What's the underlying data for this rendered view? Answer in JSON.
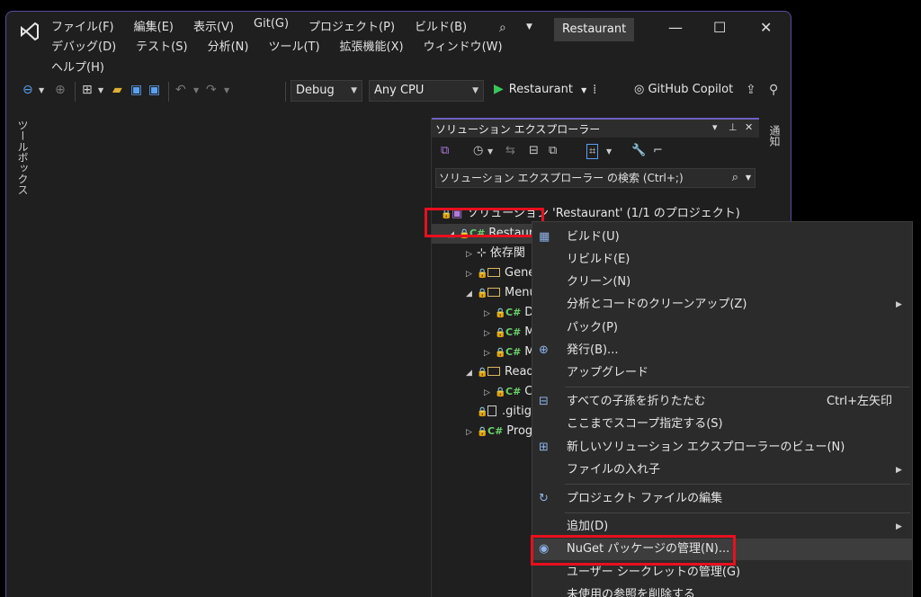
{
  "titlebar": {
    "menu_row1": [
      "ファイル(F)",
      "編集(E)",
      "表示(V)",
      "Git(G)",
      "プロジェクト(P)",
      "ビルド(B)"
    ],
    "menu_row2": [
      "デバッグ(D)",
      "テスト(S)",
      "分析(N)",
      "ツール(T)",
      "拡張機能(X)",
      "ウィンドウ(W)"
    ],
    "menu_row3": [
      "ヘルプ(H)"
    ],
    "solution_name": "Restaurant",
    "search_icon": "search-icon"
  },
  "toolbar": {
    "configuration": "Debug",
    "platform": "Any CPU",
    "run_target": "Restaurant",
    "copilot": "GitHub Copilot"
  },
  "toolbox": {
    "label": "ツールボックス"
  },
  "notifications": {
    "label": "通知"
  },
  "solution_explorer": {
    "title": "ソリューション エクスプローラー",
    "search_placeholder": "ソリューション エクスプローラー の検索 (Ctrl+;)",
    "tree": {
      "solution": "ソリューション 'Restaurant' (1/1 のプロジェクト)",
      "project": "Restaurant",
      "items": [
        "依存関",
        "Gene",
        "Menu",
        "D",
        "M",
        "M",
        "Read",
        "C",
        ".gitig",
        "Prog"
      ]
    }
  },
  "context_menu": {
    "items": [
      {
        "label": "ビルド(U)",
        "icon": "build-icon"
      },
      {
        "label": "リビルド(E)"
      },
      {
        "label": "クリーン(N)"
      },
      {
        "label": "分析とコードのクリーンアップ(Z)",
        "submenu": true
      },
      {
        "label": "パック(P)"
      },
      {
        "label": "発行(B)...",
        "icon": "globe-icon"
      },
      {
        "label": "アップグレード"
      },
      {
        "label": "すべての子孫を折りたたむ",
        "shortcut": "Ctrl+左矢印",
        "icon": "collapse-icon"
      },
      {
        "label": "ここまでスコープ指定する(S)"
      },
      {
        "label": "新しいソリューション エクスプローラーのビュー(N)",
        "icon": "new-view-icon"
      },
      {
        "label": "ファイルの入れ子",
        "submenu": true
      },
      {
        "label": "プロジェクト ファイルの編集",
        "icon": "edit-project-icon"
      },
      {
        "label": "追加(D)",
        "submenu": true
      },
      {
        "label": "NuGet パッケージの管理(N)...",
        "icon": "nuget-icon"
      },
      {
        "label": "ユーザー シークレットの管理(G)"
      },
      {
        "label": "未使用の参照を削除する"
      }
    ]
  },
  "colors": {
    "accent": "#6d5fc0",
    "highlight": "#e8101e",
    "play": "#39c55e",
    "csharp": "#6bd36b"
  }
}
